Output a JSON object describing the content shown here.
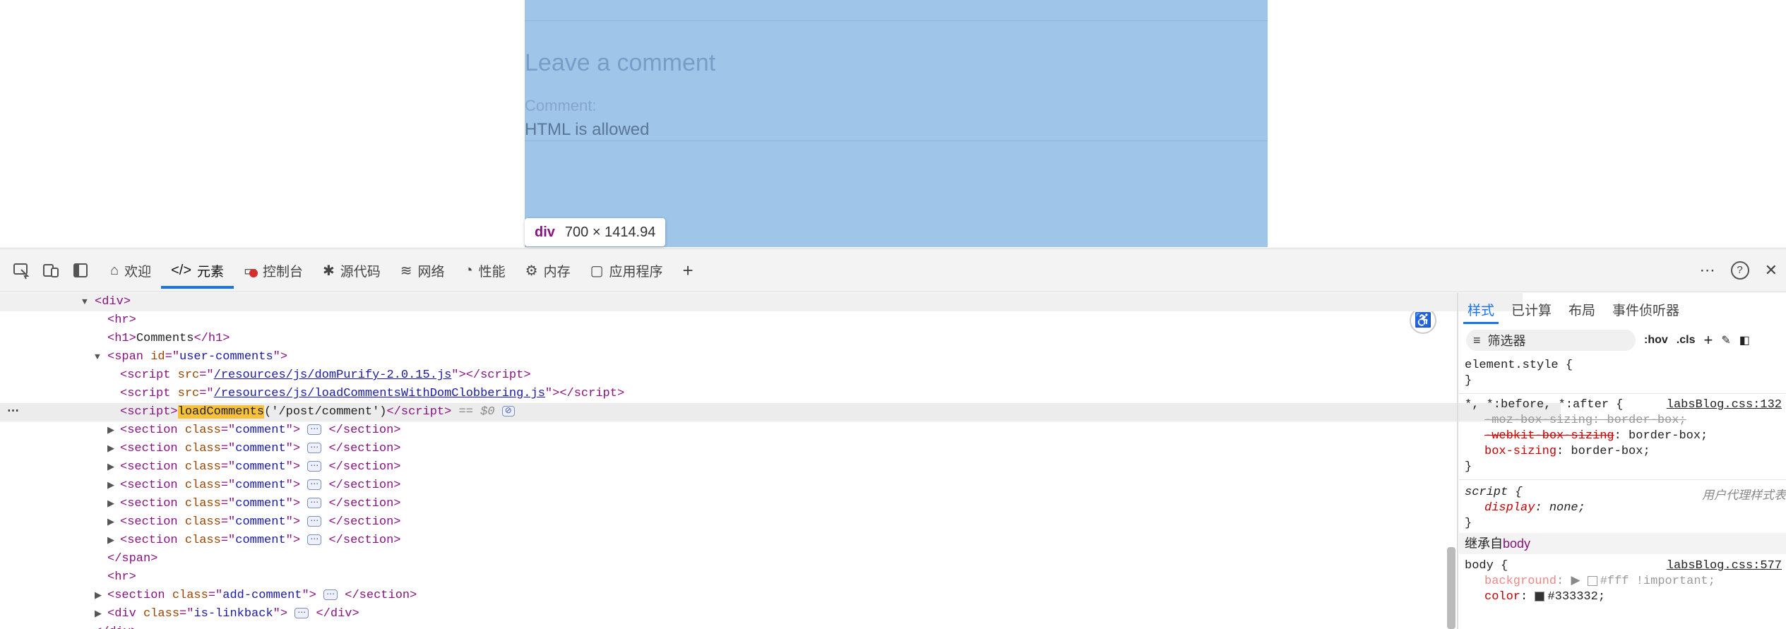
{
  "page": {
    "heading": "Leave a comment",
    "comment_label": "Comment:",
    "comment_text": "HTML is allowed"
  },
  "tooltip": {
    "tag": "div",
    "size": "700 × 1414.94"
  },
  "toolbar": {
    "tabs": [
      {
        "label": "欢迎",
        "icon": "home-icon"
      },
      {
        "label": "元素",
        "icon": "elements-icon"
      },
      {
        "label": "控制台",
        "icon": "console-icon"
      },
      {
        "label": "源代码",
        "icon": "bug-icon"
      },
      {
        "label": "网络",
        "icon": "wifi-icon"
      },
      {
        "label": "性能",
        "icon": "gauge-icon"
      },
      {
        "label": "内存",
        "icon": "chip-icon"
      },
      {
        "label": "应用程序",
        "icon": "app-window-icon"
      }
    ],
    "active_tab": "元素",
    "colors": {
      "accent": "#1a73e8",
      "highlight": "#9fc5e8",
      "tag": "#881280",
      "attr": "#994500",
      "value": "#1a1aa6",
      "search_hit": "#f7c23a",
      "error": "#d32f2f"
    }
  },
  "dom": {
    "div_open": "div",
    "hr1": "hr",
    "h1_text": "Comments",
    "span_id": "user-comments",
    "script1_src": "/resources/js/domPurify-2.0.15.js",
    "script2_src": "/resources/js/loadCommentsWithDomClobbering.js",
    "script3_fn": "loadComments",
    "script3_arg": "('/post/comment')",
    "selected_marker": "== $0",
    "section_class": "comment",
    "section_count": 7,
    "section2_class": "add-comment",
    "div2_class": "is-linkback"
  },
  "styles": {
    "tabs": [
      "样式",
      "已计算",
      "布局",
      "事件侦听器"
    ],
    "filter_placeholder": "筛选器",
    "hov": ":hov",
    "cls": ".cls",
    "element_style": "element.style {",
    "universal_selector": "*, *:before, *:after {",
    "universal_source": "labsBlog.css:132",
    "moz_box_sizing": "-moz-box-sizing: border-box;",
    "webkit_box_sizing_prop": "-webkit-box-sizing",
    "webkit_box_sizing_val": ": border-box;",
    "box_sizing_prop": "box-sizing",
    "box_sizing_val": ": border-box;",
    "script_selector": "script {",
    "ua_label": "用户代理样式表",
    "display_prop": "display",
    "display_val": ": none;",
    "inherited_label": "继承自",
    "inherited_from": "body",
    "body_selector": "body {",
    "body_source": "labsBlog.css:577",
    "background_prop": "background",
    "background_val": "#fff !important;",
    "color_prop": "color",
    "color_val": "#333332;"
  }
}
